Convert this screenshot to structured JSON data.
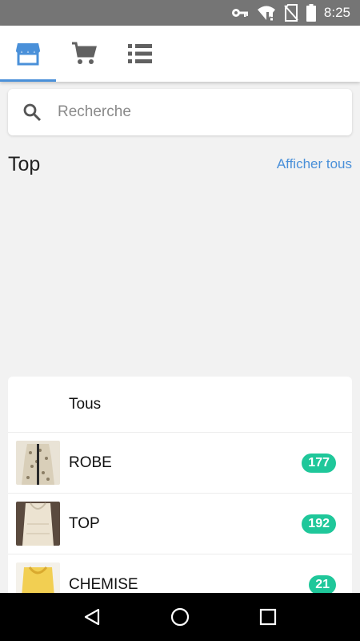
{
  "status_bar": {
    "time": "8:25",
    "icons": [
      "key-icon",
      "wifi-alert-icon",
      "no-sim-icon",
      "battery-icon"
    ]
  },
  "tabs": [
    {
      "name": "store-icon",
      "active": true
    },
    {
      "name": "cart-icon",
      "active": false
    },
    {
      "name": "list-icon",
      "active": false
    }
  ],
  "search": {
    "placeholder": "Recherche"
  },
  "top_section": {
    "title": "Top",
    "show_all": "Afficher tous"
  },
  "categories": [
    {
      "label": "Tous",
      "count": null
    },
    {
      "label": "ROBE",
      "count": "177"
    },
    {
      "label": "TOP",
      "count": "192"
    },
    {
      "label": "CHEMISE",
      "count": "21"
    }
  ],
  "colors": {
    "accent": "#4a90d9",
    "badge": "#1fc79a",
    "status_bar": "#757575"
  },
  "nav_bar": {
    "icons": [
      "back-icon",
      "home-icon",
      "recents-icon"
    ]
  }
}
